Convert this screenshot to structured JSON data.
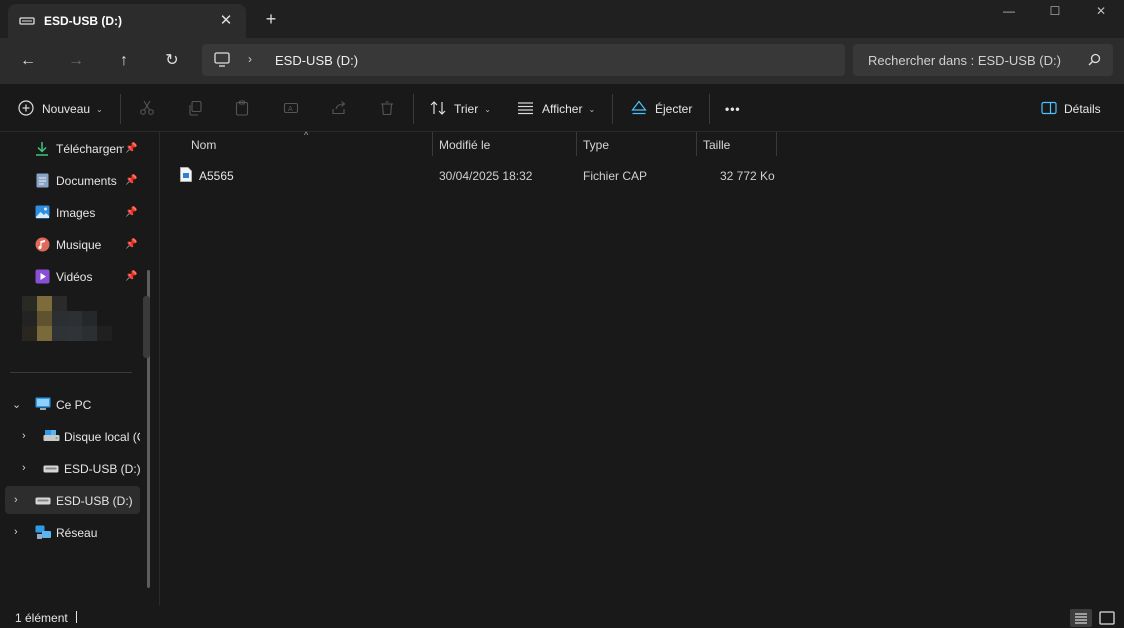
{
  "window": {
    "tab_title": "ESD-USB (D:)",
    "tab_close": "✕",
    "new_tab": "+",
    "minimize": "—",
    "maximize": "☐",
    "close": "✕"
  },
  "nav": {
    "back": "←",
    "forward": "→",
    "up": "↑",
    "refresh": "↻",
    "breadcrumb_sep": "›",
    "breadcrumb": "ESD-USB (D:)",
    "search_placeholder": "Rechercher dans : ESD-USB (D:)"
  },
  "toolbar": {
    "new_label": "Nouveau",
    "sort_label": "Trier",
    "view_label": "Afficher",
    "eject_label": "Éjecter",
    "more_label": "•••",
    "details_label": "Détails",
    "caret": "⌄"
  },
  "sidebar": {
    "quick_access": [
      {
        "label": "Téléchargem",
        "icon": "download-icon",
        "pinned": true
      },
      {
        "label": "Documents",
        "icon": "document-icon",
        "pinned": true
      },
      {
        "label": "Images",
        "icon": "image-icon",
        "pinned": true
      },
      {
        "label": "Musique",
        "icon": "music-icon",
        "pinned": true
      },
      {
        "label": "Vidéos",
        "icon": "video-icon",
        "pinned": true
      }
    ],
    "pin_glyph": "📌",
    "tree": [
      {
        "label": "Ce PC",
        "expanded": true
      },
      {
        "label": "Disque local (C",
        "expanded": false
      },
      {
        "label": "ESD-USB (D:)",
        "expanded": false
      },
      {
        "label": "ESD-USB (D:)",
        "expanded": false,
        "selected": true
      },
      {
        "label": "Réseau",
        "expanded": false
      }
    ],
    "expanded_glyph": "⌄",
    "collapsed_glyph": "›"
  },
  "columns": {
    "name": "Nom",
    "modified": "Modifié le",
    "type": "Type",
    "size": "Taille",
    "sort_indicator": "^"
  },
  "files": [
    {
      "name": "A5565",
      "modified": "30/04/2025 18:32",
      "type": "Fichier CAP",
      "size": "32 772 Ko"
    }
  ],
  "status": {
    "count": "1 élément"
  },
  "colors": {
    "background": "#191919",
    "toolbar": "#2c2c2c",
    "accent": "#4cc2ff"
  }
}
